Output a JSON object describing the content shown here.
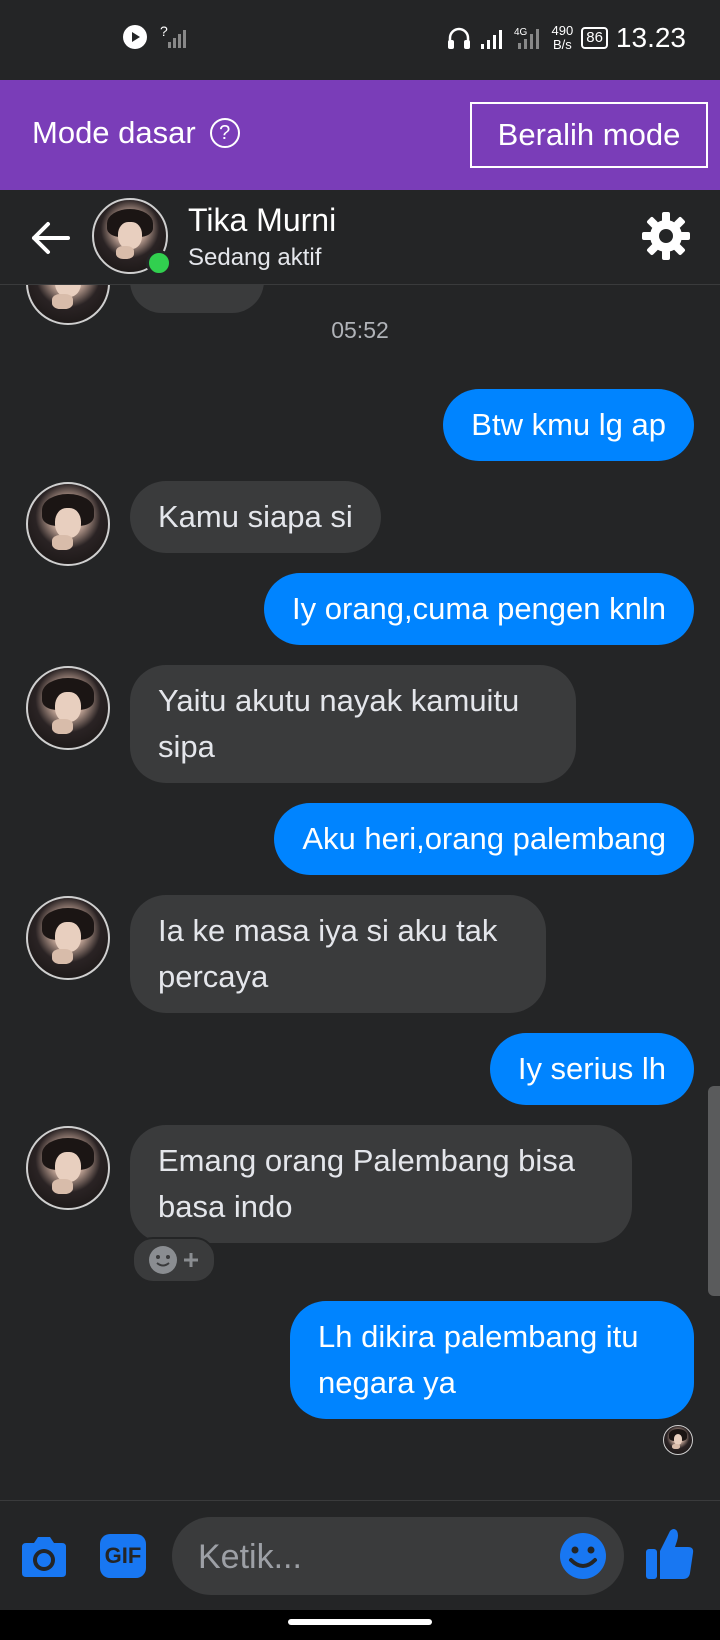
{
  "status_bar": {
    "time": "13.23",
    "speed_value": "490",
    "speed_unit": "B/s",
    "battery": "86",
    "network": "4G"
  },
  "mode_bar": {
    "label": "Mode dasar",
    "help_icon": "?",
    "switch_button": "Beralih mode"
  },
  "header": {
    "name": "Tika Murni",
    "status": "Sedang aktif"
  },
  "chat": {
    "timestamp": "05:52",
    "messages": [
      {
        "from": "me",
        "text": "Btw kmu lg ap"
      },
      {
        "from": "them",
        "text": "Kamu siapa si"
      },
      {
        "from": "me",
        "text": "Iy orang,cuma pengen knln"
      },
      {
        "from": "them",
        "text": "Yaitu akutu nayak kamuitu sipa"
      },
      {
        "from": "me",
        "text": "Aku heri,orang palembang"
      },
      {
        "from": "them",
        "text": "Ia ke masa iya si aku tak percaya"
      },
      {
        "from": "me",
        "text": "Iy serius lh"
      },
      {
        "from": "them",
        "text": "Emang orang Palembang bisa basa indo"
      },
      {
        "from": "me",
        "text": "Lh dikira palembang itu negara ya"
      }
    ]
  },
  "composer": {
    "placeholder": "Ketik...",
    "gif_label": "GIF"
  },
  "colors": {
    "mode_bar": "#7a3db8",
    "outgoing_bubble": "#0084ff",
    "incoming_bubble": "#3a3b3c",
    "online": "#31d04f"
  }
}
